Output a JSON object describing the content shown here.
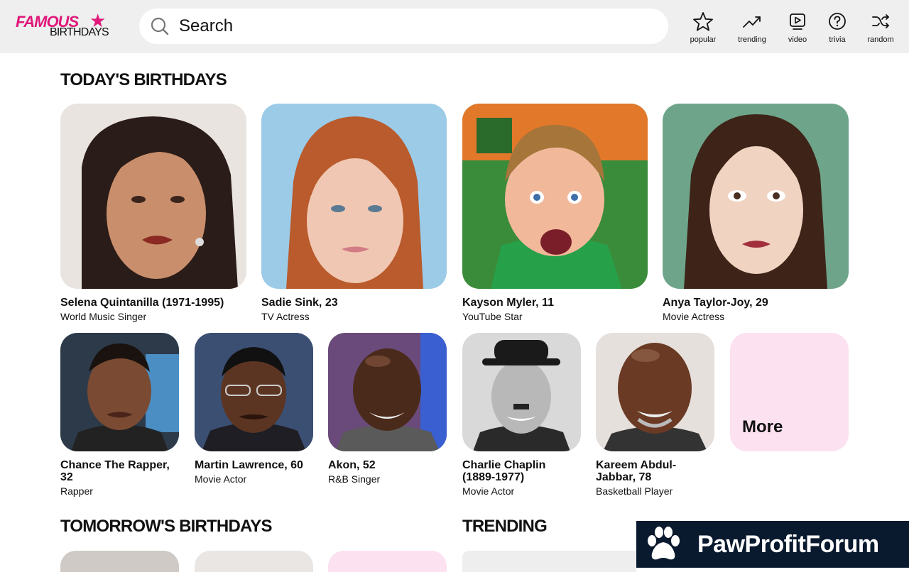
{
  "logo": {
    "line1": "FAMOUS",
    "line2": "BIRTHDAYS",
    "star": "★"
  },
  "search": {
    "placeholder": "Search",
    "icon": "search-icon"
  },
  "nav": [
    {
      "label": "popular",
      "icon": "star-icon"
    },
    {
      "label": "trending",
      "icon": "trending-icon"
    },
    {
      "label": "video",
      "icon": "video-icon"
    },
    {
      "label": "trivia",
      "icon": "question-icon"
    },
    {
      "label": "random",
      "icon": "shuffle-icon"
    }
  ],
  "todays_birthdays": {
    "title": "TODAY'S BIRTHDAYS",
    "featured": [
      {
        "name": "Selena Quintanilla (1971-1995)",
        "job": "World Music Singer"
      },
      {
        "name": "Sadie Sink, 23",
        "job": "TV Actress"
      },
      {
        "name": "Kayson Myler, 11",
        "job": "YouTube Star"
      },
      {
        "name": "Anya Taylor-Joy, 29",
        "job": "Movie Actress"
      }
    ],
    "others": [
      {
        "name": "Chance The Rapper, 32",
        "job": "Rapper"
      },
      {
        "name": "Martin Lawrence, 60",
        "job": "Movie Actor"
      },
      {
        "name": "Akon, 52",
        "job": "R&B Singer"
      },
      {
        "name": "Charlie Chaplin (1889-1977)",
        "job": "Movie Actor"
      },
      {
        "name": "Kareem Abdul-Jabbar, 78",
        "job": "Basketball Player"
      }
    ],
    "more_label": "More"
  },
  "tomorrows_birthdays": {
    "title": "TOMORROW'S BIRTHDAYS"
  },
  "trending": {
    "title": "TRENDING"
  },
  "watermark": {
    "text": "PawProfitForum",
    "icon": "paw-icon"
  },
  "colors": {
    "brand": "#e0187a",
    "header_bg": "#efefef",
    "more_tile": "#fce1f0",
    "watermark_bg": "#0a1a2e"
  }
}
